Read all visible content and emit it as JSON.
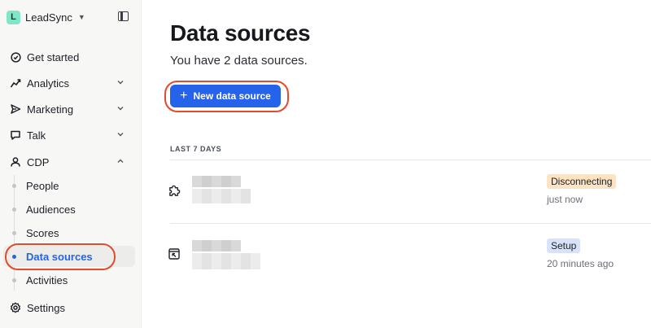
{
  "workspace": {
    "initial": "L",
    "name": "LeadSync"
  },
  "sidebar": {
    "items": [
      {
        "label": "Get started"
      },
      {
        "label": "Analytics"
      },
      {
        "label": "Marketing"
      },
      {
        "label": "Talk"
      },
      {
        "label": "CDP"
      },
      {
        "label": "Settings"
      }
    ],
    "cdp_subitems": [
      {
        "label": "People"
      },
      {
        "label": "Audiences"
      },
      {
        "label": "Scores"
      },
      {
        "label": "Data sources",
        "active": true
      },
      {
        "label": "Activities"
      }
    ]
  },
  "main": {
    "title": "Data sources",
    "subtitle": "You have 2 data sources.",
    "new_button_label": "New data source",
    "section_label": "LAST 7 DAYS",
    "rows": [
      {
        "status": "Disconnecting",
        "status_color": "#fbe3c4",
        "time": "just now",
        "icon": "puzzle-icon"
      },
      {
        "status": "Setup",
        "status_color": "#d8e3fb",
        "time": "20 minutes ago",
        "icon": "box-arrow-icon"
      }
    ]
  },
  "colors": {
    "accent": "#2563eb",
    "highlight": "#e24b2c"
  }
}
